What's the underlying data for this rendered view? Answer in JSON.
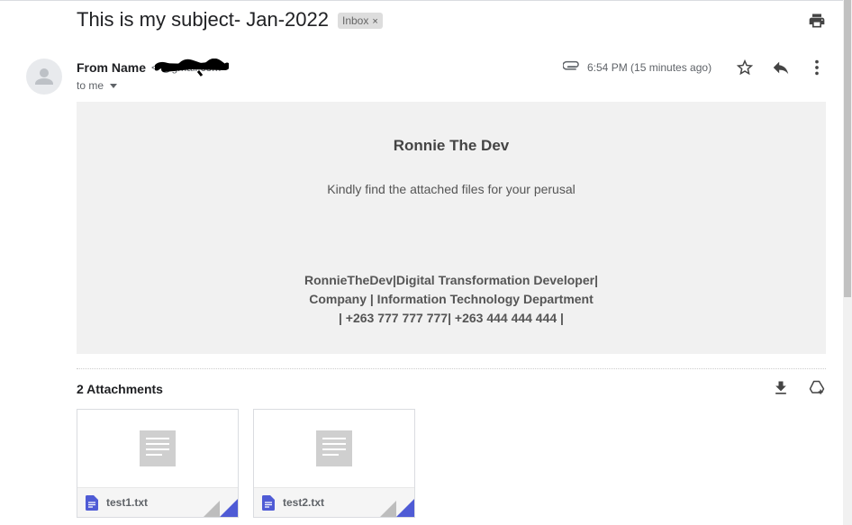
{
  "email": {
    "subject": "This is my subject- Jan-2022",
    "label": "Inbox",
    "label_remove": "×",
    "sender_name": "From Name",
    "sender_email": "<                    @gmail.com>",
    "recipient": "to me",
    "time": "6:54 PM (15 minutes ago)"
  },
  "body": {
    "title": "Ronnie The Dev",
    "message": "Kindly find the attached files for your perusal",
    "signature": [
      "RonnieTheDev|Digital Transformation Developer|",
      "Company | Information Technology Department",
      "| +263 777 777 777| +263 444 444 444 |"
    ]
  },
  "attachments": {
    "title": "2 Attachments",
    "files": [
      {
        "name": "test1.txt"
      },
      {
        "name": "test2.txt"
      }
    ]
  },
  "colors": {
    "body_bg": "#f1f1f1",
    "doc_icon": "#4f5bd5",
    "chip_bg": "#dddddd"
  }
}
